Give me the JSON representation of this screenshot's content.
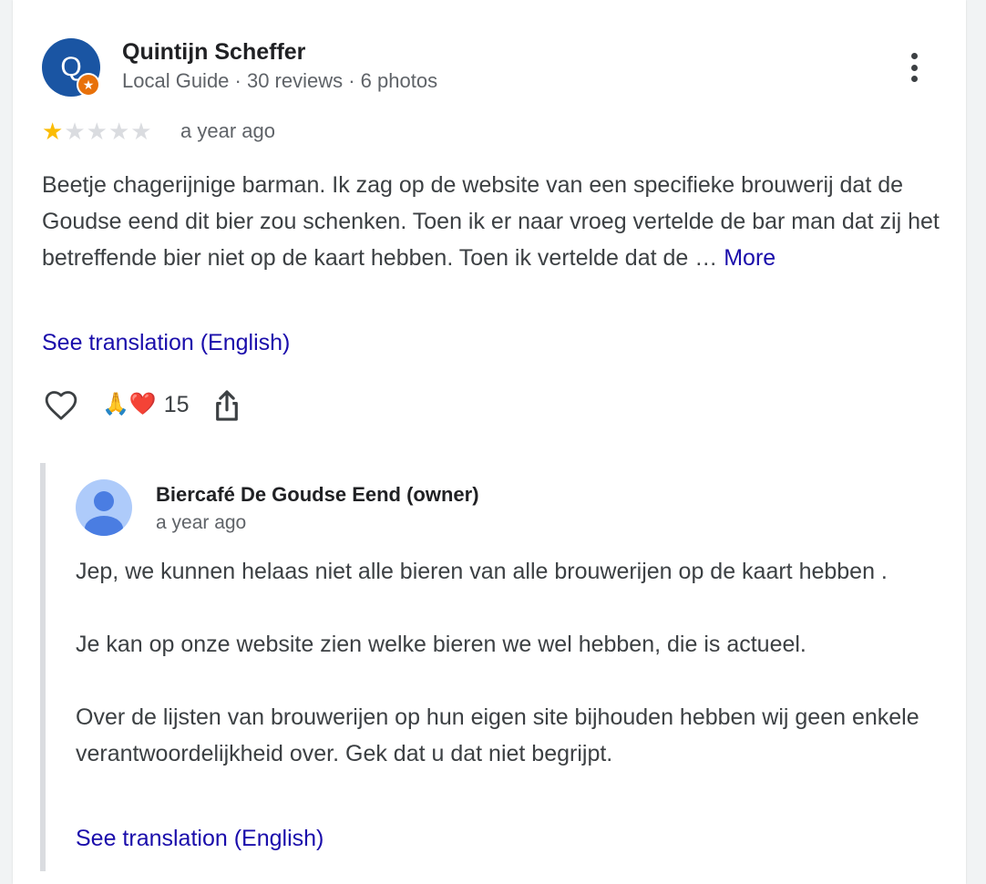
{
  "review": {
    "reviewer": {
      "initial": "Q",
      "name": "Quintijn Scheffer",
      "meta": "Local Guide · 30 reviews · 6 photos",
      "avatar_color": "#1a55a3",
      "badge_color": "#e8710a",
      "badge_icon": "star-icon"
    },
    "rating": {
      "value": 1,
      "max": 5,
      "star_color": "#fbbc04"
    },
    "timestamp": "a year ago",
    "text": "Beetje chagerijnige barman. Ik zag op de website van een specifieke brouwerij dat de Goudse eend dit bier zou schenken. Toen ik er naar vroeg vertelde de bar man dat zij het betreffende bier niet op de kaart hebben. Toen ik vertelde dat de …",
    "more_label": "More",
    "translation_label": "See translation (English)",
    "actions": {
      "like_icon": "heart-outline-icon",
      "reaction_emojis": "🙏❤️",
      "reaction_count": "15",
      "share_icon": "share-icon",
      "menu_icon": "more-vertical-icon"
    }
  },
  "reply": {
    "owner_name": "Biercafé De Goudse Eend (owner)",
    "timestamp": "a year ago",
    "paragraphs": [
      "Jep, we kunnen helaas niet alle bieren van alle brouwerijen op de kaart hebben .",
      "Je kan op onze website zien welke bieren we wel hebben, die is actueel.",
      "Over de lijsten van brouwerijen op hun eigen site bijhouden hebben wij geen enkele verantwoordelijkheid over. Gek dat u dat niet begrijpt."
    ],
    "translation_label": "See translation (English)",
    "avatar_icon": "person-icon"
  },
  "colors": {
    "link": "#1a0dab",
    "text": "#3c4043",
    "secondary": "#5f6368"
  }
}
